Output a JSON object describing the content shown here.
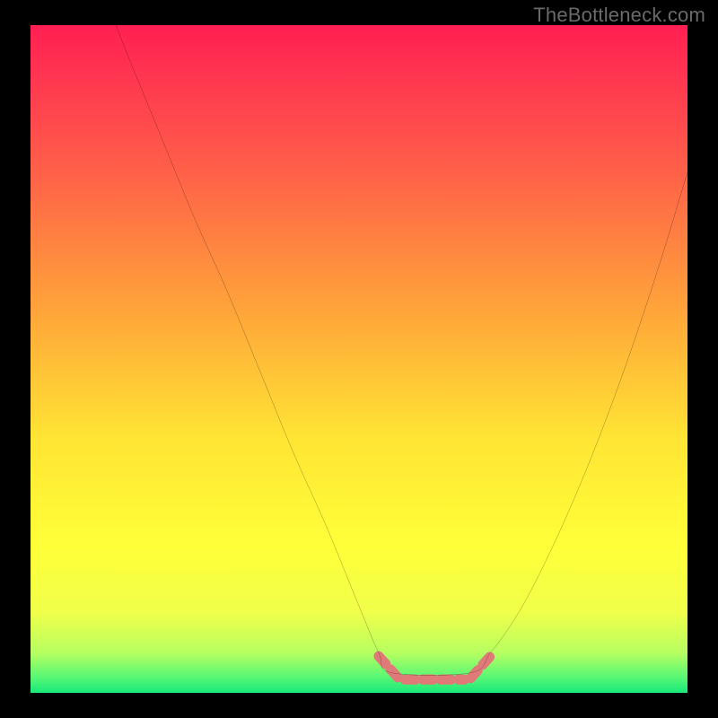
{
  "watermark": {
    "text": "TheBottleneck.com"
  },
  "chart_data": {
    "type": "line",
    "title": "",
    "xlabel": "",
    "ylabel": "",
    "xlim": [
      0,
      100
    ],
    "ylim": [
      0,
      100
    ],
    "grid": false,
    "series": [
      {
        "name": "curve",
        "color": "#000000",
        "x": [
          13,
          15,
          20,
          25,
          30,
          35,
          40,
          45,
          50,
          53,
          55,
          67,
          70,
          73,
          76,
          80,
          84,
          88,
          92,
          96,
          100
        ],
        "y": [
          100,
          95,
          83,
          71,
          60,
          48,
          36,
          25,
          13,
          6,
          3,
          3,
          6,
          10,
          15,
          23,
          32,
          42,
          53,
          65,
          78
        ]
      }
    ],
    "zero_band": {
      "color": "#e07a78",
      "segments": [
        {
          "x1": 53,
          "y1": 5.5,
          "x2": 56,
          "y2": 2.2
        },
        {
          "x1": 57,
          "y1": 2.0,
          "x2": 66,
          "y2": 2.0
        },
        {
          "x1": 67,
          "y1": 2.2,
          "x2": 70,
          "y2": 5.5
        }
      ]
    },
    "background_gradient": {
      "stops": [
        {
          "offset": 0.0,
          "color": "#ff1f53"
        },
        {
          "offset": 0.2,
          "color": "#ff5a4a"
        },
        {
          "offset": 0.42,
          "color": "#ffa23a"
        },
        {
          "offset": 0.62,
          "color": "#ffe534"
        },
        {
          "offset": 0.78,
          "color": "#ffff38"
        },
        {
          "offset": 0.88,
          "color": "#f0ff4a"
        },
        {
          "offset": 0.94,
          "color": "#b6ff60"
        },
        {
          "offset": 0.975,
          "color": "#5cf874"
        },
        {
          "offset": 1.0,
          "color": "#18e87a"
        }
      ]
    }
  }
}
